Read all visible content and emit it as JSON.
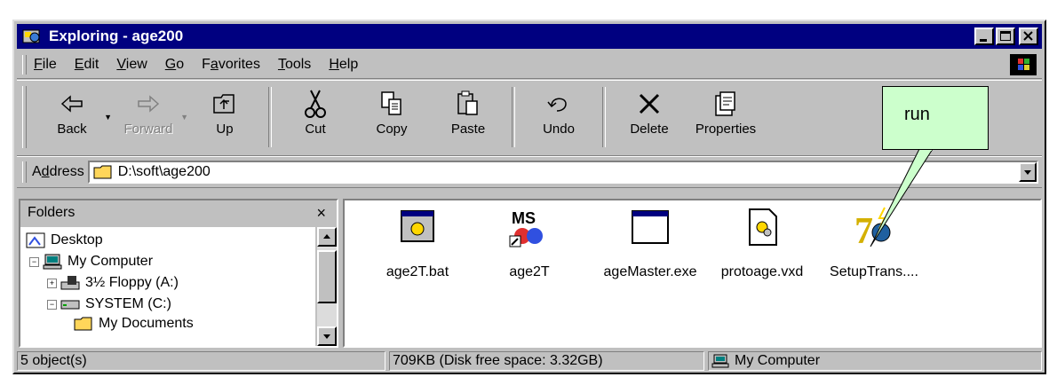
{
  "window": {
    "title": "Exploring - age200",
    "controls": [
      "minimize",
      "maximize",
      "close"
    ]
  },
  "menu": {
    "items": [
      "File",
      "Edit",
      "View",
      "Go",
      "Favorites",
      "Tools",
      "Help"
    ],
    "underlined": [
      "F",
      "E",
      "V",
      "G",
      "a",
      "T",
      "H"
    ]
  },
  "toolbar": {
    "back": "Back",
    "forward": "Forward",
    "up": "Up",
    "cut": "Cut",
    "copy": "Copy",
    "paste": "Paste",
    "undo": "Undo",
    "delete": "Delete",
    "properties": "Properties"
  },
  "callout": {
    "text": "run"
  },
  "address": {
    "label": "Address",
    "value": "D:\\soft\\age200"
  },
  "folders": {
    "title": "Folders",
    "close": "×",
    "tree": [
      "Desktop",
      "My Computer",
      "3½ Floppy (A:)",
      "SYSTEM (C:)",
      "My Documents"
    ]
  },
  "files": [
    {
      "name": "age2T.bat",
      "icon": "batch-file-icon"
    },
    {
      "name": "age2T",
      "icon": "ms-dos-shortcut-icon"
    },
    {
      "name": "ageMaster.exe",
      "icon": "application-window-icon"
    },
    {
      "name": "protoage.vxd",
      "icon": "system-file-gear-icon"
    },
    {
      "name": "SetupTrans....",
      "icon": "setup-globe-icon"
    }
  ],
  "status": {
    "objects": "5 object(s)",
    "size": "709KB (Disk free space: 3.32GB)",
    "location": "My Computer"
  },
  "colors": {
    "titlebar": "#000080",
    "face": "#c0c0c0",
    "callout": "#ccffcc"
  }
}
